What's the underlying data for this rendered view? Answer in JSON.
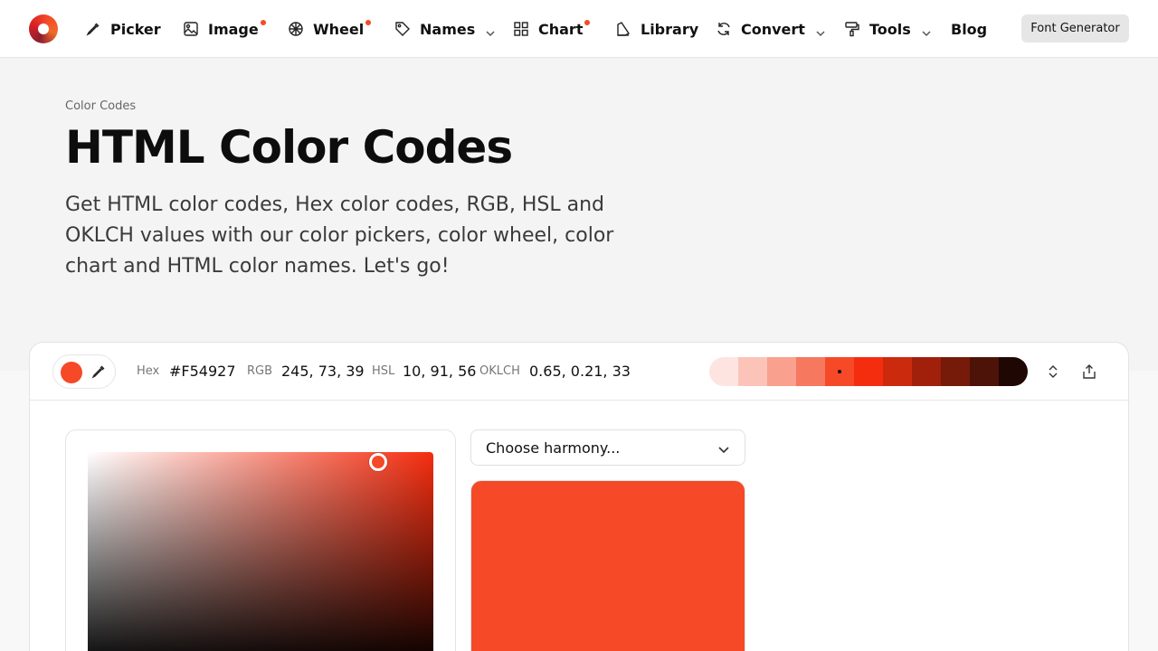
{
  "nav": {
    "items": [
      {
        "label": "Picker",
        "icon": "eyedropper-icon",
        "dot": false,
        "chevron": false
      },
      {
        "label": "Image",
        "icon": "image-icon",
        "dot": true,
        "chevron": false
      },
      {
        "label": "Wheel",
        "icon": "wheel-icon",
        "dot": true,
        "chevron": false
      },
      {
        "label": "Names",
        "icon": "tag-icon",
        "dot": false,
        "chevron": true
      },
      {
        "label": "Chart",
        "icon": "grid-icon",
        "dot": true,
        "chevron": false
      },
      {
        "label": "Library",
        "icon": "book-icon",
        "dot": false,
        "chevron": false
      },
      {
        "label": "Convert",
        "icon": "refresh-icon",
        "dot": false,
        "chevron": true
      },
      {
        "label": "Tools",
        "icon": "paint-roller-icon",
        "dot": false,
        "chevron": true
      },
      {
        "label": "Blog",
        "icon": "",
        "dot": false,
        "chevron": false
      }
    ],
    "cta_label": "Font Generator"
  },
  "hero": {
    "breadcrumb": "Color Codes",
    "title": "HTML Color Codes",
    "subtitle": "Get HTML color codes, Hex color codes, RGB, HSL and OKLCH values with our color pickers, color wheel, color chart and HTML color names. Let's go!"
  },
  "picker": {
    "hex_label": "Hex",
    "hex": "#F54927",
    "rgb_label": "RGB",
    "rgb": "245, 73, 39",
    "hsl_label": "HSL",
    "hsl": "10, 91, 56",
    "oklch_label": "OKLCH",
    "oklch": "0.65, 0.21, 33",
    "harmony_placeholder": "Choose harmony...",
    "current_color": "#F54927",
    "scale": [
      "#fde4e0",
      "#fcc4b8",
      "#f9a08e",
      "#f6785f",
      "#f54927",
      "#f52d0f",
      "#cc2a0c",
      "#a0200b",
      "#761a0a",
      "#4d1208",
      "#1f0704"
    ],
    "selected_index": 4
  },
  "colors": {
    "accent": "#F54927"
  }
}
